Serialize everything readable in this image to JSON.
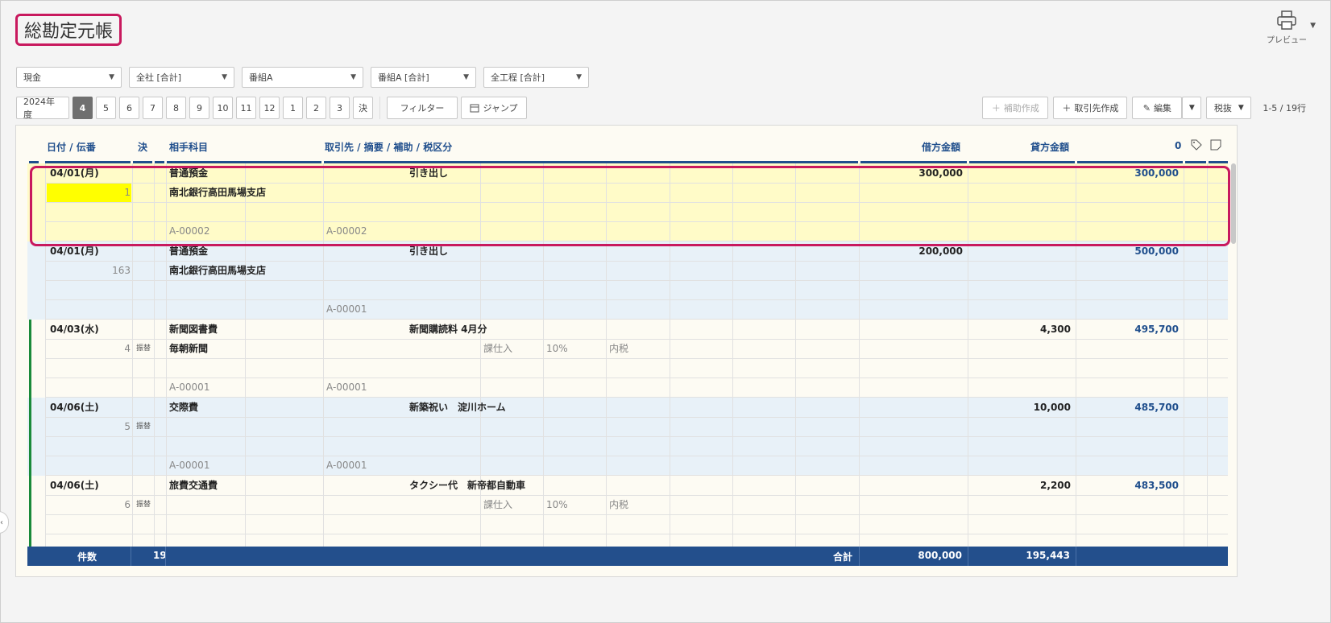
{
  "title": "総勘定元帳",
  "preview_label": "プレビュー",
  "filters": [
    "現金",
    "全社 [合計]",
    "番組A",
    "番組A [合計]",
    "全工程 [合計]"
  ],
  "fiscal_year": "2024年度",
  "months": [
    "4",
    "5",
    "6",
    "7",
    "8",
    "9",
    "10",
    "11",
    "12",
    "1",
    "2",
    "3",
    "決"
  ],
  "filter_label": "フィルター",
  "jump_label": "ジャンプ",
  "toolbar": {
    "aux_create": "補助作成",
    "partner_create": "取引先作成",
    "edit": "編集",
    "tax": "税抜",
    "pager": "1-5 / 19行"
  },
  "headers": {
    "date": "日付 / 伝番",
    "settle": "決",
    "account": "相手科目",
    "partner": "取引先 / 摘要 / 補助 / 税区分",
    "debit": "借方金額",
    "credit": "貸方金額",
    "balance": "0"
  },
  "entries": [
    {
      "date": "04/01(月)",
      "no": "1",
      "settle": "",
      "account": "普通預金",
      "summary": "引き出し",
      "sub": "南北銀行高田馬場支店",
      "tax_type": "",
      "tax_rate": "",
      "tax_incl": "",
      "code_left": "A-00002",
      "code_right": "A-00002",
      "debit": "300,000",
      "credit": "",
      "balance": "300,000"
    },
    {
      "date": "04/01(月)",
      "no": "163",
      "settle": "",
      "account": "普通預金",
      "summary": "引き出し",
      "sub": "南北銀行高田馬場支店",
      "tax_type": "",
      "tax_rate": "",
      "tax_incl": "",
      "code_left": "",
      "code_right": "A-00001",
      "debit": "200,000",
      "credit": "",
      "balance": "500,000"
    },
    {
      "date": "04/03(水)",
      "no": "4",
      "settle": "振替",
      "account": "新聞図書費",
      "summary": "新聞購読料 4月分",
      "sub": "毎朝新聞",
      "tax_type": "課仕入",
      "tax_rate": "10%",
      "tax_incl": "内税",
      "code_left": "A-00001",
      "code_right": "A-00001",
      "debit": "",
      "credit": "4,300",
      "balance": "495,700"
    },
    {
      "date": "04/06(土)",
      "no": "5",
      "settle": "振替",
      "account": "交際費",
      "summary": "新築祝い　淀川ホーム",
      "sub": "",
      "tax_type": "",
      "tax_rate": "",
      "tax_incl": "",
      "code_left": "A-00001",
      "code_right": "A-00001",
      "debit": "",
      "credit": "10,000",
      "balance": "485,700"
    },
    {
      "date": "04/06(土)",
      "no": "6",
      "settle": "振替",
      "account": "旅費交通費",
      "summary": "タクシー代　新帝都自動車",
      "sub": "",
      "tax_type": "課仕入",
      "tax_rate": "10%",
      "tax_incl": "内税",
      "code_left": "",
      "code_right": "",
      "debit": "",
      "credit": "2,200",
      "balance": "483,500"
    }
  ],
  "footer": {
    "count_label": "件数",
    "count": "19",
    "total_label": "合計",
    "debit_total": "800,000",
    "credit_total": "195,443"
  },
  "colors": {
    "accent": "#1f4e8c",
    "highlight_border": "#c8195e",
    "selected_row": "#fffbc8",
    "alt_row": "#e8f1f8",
    "entry_bar": "#1a8a3a"
  }
}
